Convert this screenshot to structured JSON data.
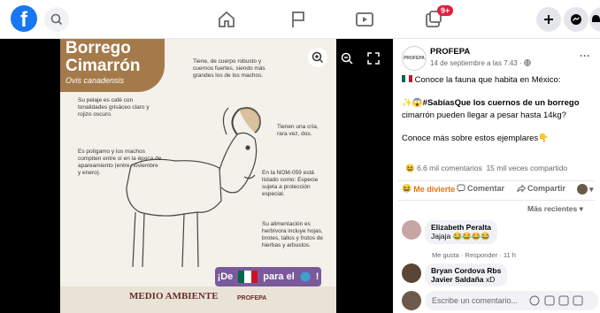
{
  "topbar": {
    "logo": "f",
    "notif_count": "9+"
  },
  "poster": {
    "title_1": "Borrego",
    "title_2": "Cimarrón",
    "subtitle": "Ovis canadensis",
    "note_horns": "Tiene, de cuerpo robusto y cuernos fuertes, siendo más grandes los de los machos.",
    "note_coat": "Su pelaje es café con tonalidades grisáceo claro y rojizo oscuro.",
    "note_young": "Tienen una cría, rara vez, dos.",
    "note_poly": "Es polígamo y los machos compiten entre sí en la época de apareamiento (entre noviembre y enero).",
    "note_nom": "En la NOM-059 está listado como: Especie sujeta a protección especial.",
    "note_food": "Su alimentación es herbívora incluye hojas, brotes, tallos y frutos de hierbas y arbustos.",
    "banner_left": "¡De",
    "banner_right": "para el",
    "banner_end": "!",
    "gov": "MEDIO AMBIENTE",
    "gov2": "PROFEPA"
  },
  "post": {
    "avatar_text": "PROFEPA",
    "page_name": "PROFEPA",
    "time": "14 de septiembre a las 7:43 ·",
    "line1": "Conoce la fauna que habita en México:",
    "line2a": "#SabíasQue los cuernos de un borrego",
    "line2b": "cimarrón pueden llegar a pesar hasta 14kg?",
    "line3": "Conoce más sobre estos ejemplares👇",
    "reactions": "6.6 mil",
    "comments": "comentarios",
    "shares": "15 mil veces compartido",
    "act_react": "Me divierte",
    "act_comment": "Comentar",
    "act_share": "Compartir",
    "sort": "Más recientes"
  },
  "comments": [
    {
      "name": "Elizabeth Peralta",
      "text": "Jajaja 😂😂😂😂"
    },
    {
      "name": "Bryan Cordova Rbs",
      "tag": "Javier Saldaña",
      "text": "xD"
    }
  ],
  "comment_meta": {
    "like": "Me gusta",
    "reply": "Responder",
    "time": "11 h"
  },
  "composer": {
    "placeholder": "Escribe un comentario..."
  }
}
